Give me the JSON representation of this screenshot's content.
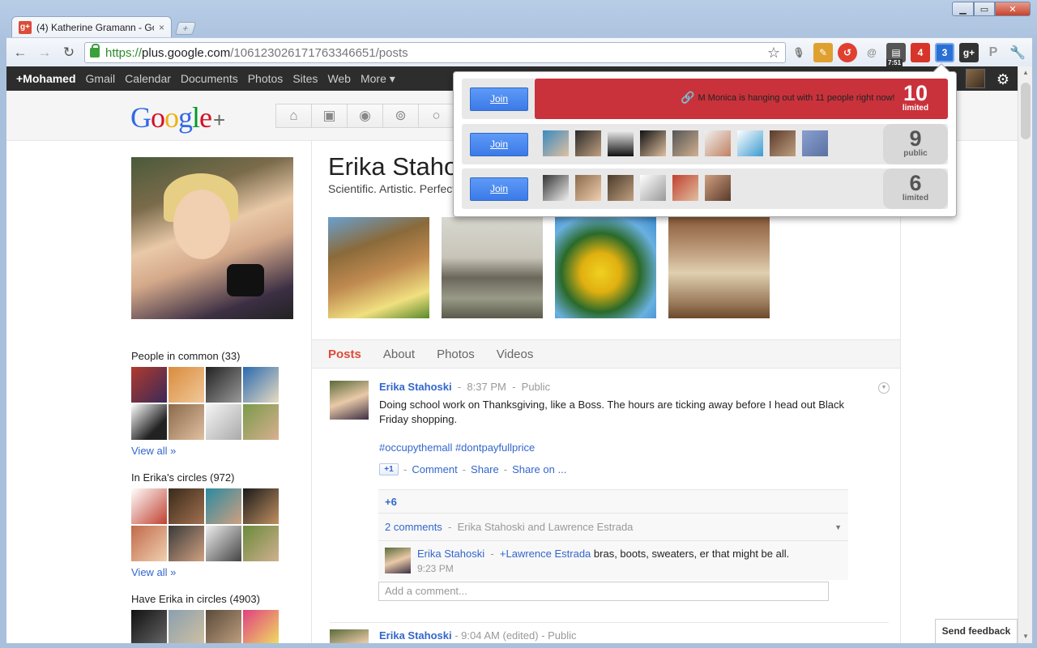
{
  "browser": {
    "tab_title": "(4) Katherine Gramann - Go",
    "tab_favicon": "g+",
    "tab_close": "×",
    "new_tab": "+",
    "url_scheme": "https://",
    "url_host": "plus.google.com",
    "url_path": "/106123026171763346651/posts",
    "extension_badges": {
      "clock": "7:51",
      "red_count": "4",
      "blue_count": "3"
    }
  },
  "gbar": {
    "items": [
      "+Mohamed",
      "Gmail",
      "Calendar",
      "Documents",
      "Photos",
      "Sites",
      "Web",
      "More ▾"
    ]
  },
  "logo": {
    "g1": "G",
    "o1": "o",
    "o2": "o",
    "g2": "g",
    "l": "l",
    "e": "e",
    "plus": "+"
  },
  "profile": {
    "name": "Erika Stahoski",
    "tagline": "Scientific. Artistic. Perfectionist."
  },
  "sidebar": {
    "common_title": "People in common (33)",
    "circles_title": "In Erika's circles (972)",
    "have_title": "Have Erika in circles (4903)",
    "view_all": "View all »"
  },
  "tabs": [
    "Posts",
    "About",
    "Photos",
    "Videos"
  ],
  "post": {
    "author": "Erika Stahoski",
    "sep": "-",
    "time": "8:37 PM",
    "visibility": "Public",
    "text": "Doing school work on Thanksgiving, like a Boss. The hours are ticking away before I head out Black Friday shopping.",
    "hashtags": "#occupythemall #dontpayfullprice",
    "plusone": "+1",
    "comment": "Comment",
    "share": "Share",
    "share_on": "Share on ...",
    "plus_count": "+6",
    "comments_count": "2 comments",
    "commenters": "Erika Stahoski and Lawrence Estrada",
    "comment_author": "Erika Stahoski",
    "comment_mention": "+Lawrence Estrada",
    "comment_text": "bras, boots, sweaters, er that might be all.",
    "comment_time": "9:23 PM",
    "add_comment": "Add a comment..."
  },
  "post2": {
    "author": "Erika Stahoski",
    "meta": "- 9:04 AM (edited) - Public"
  },
  "feedback": "Send feedback",
  "hangouts": {
    "join": "Join",
    "rows": [
      {
        "message": "M Monica is hanging out with 11 people right now!",
        "count": "10",
        "type": "limited"
      },
      {
        "count": "9",
        "type": "public"
      },
      {
        "count": "6",
        "type": "limited"
      }
    ]
  },
  "colors": {
    "accent_red": "#dd4b39",
    "link_blue": "#3366cc",
    "hangout_red": "#c9323b",
    "join_blue": "#4a8af4"
  }
}
